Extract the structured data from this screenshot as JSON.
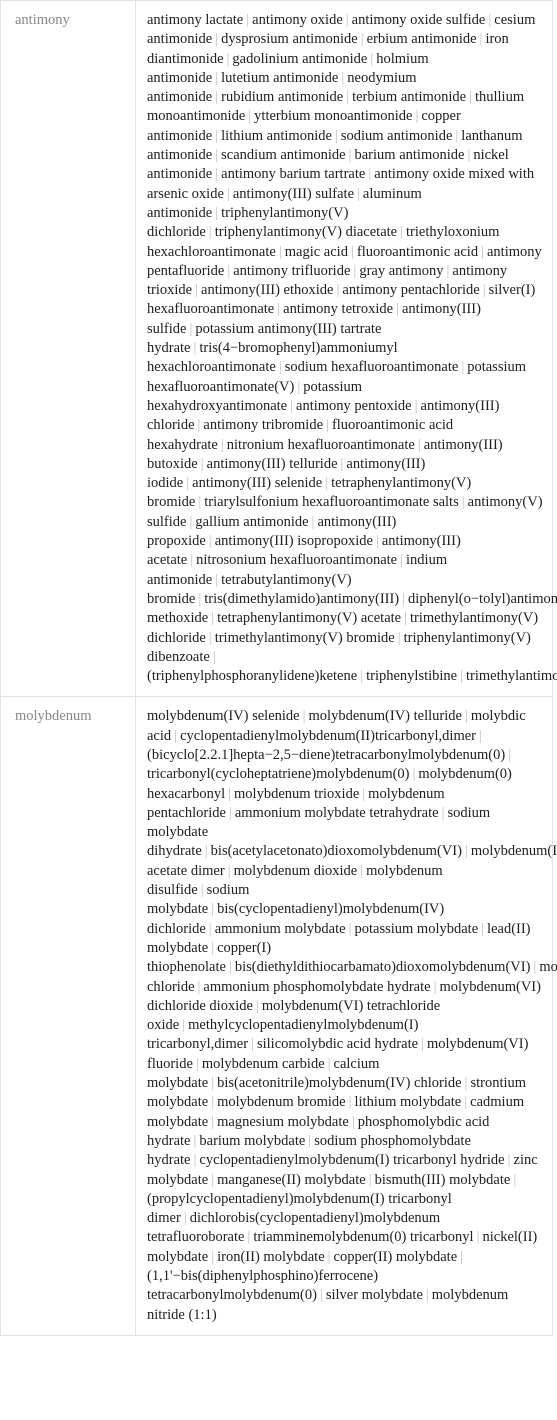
{
  "table": {
    "separator": "|",
    "label_color": "#888888",
    "value_color": "#202020",
    "border_color": "#e2e2e2",
    "separator_color": "#c0c0c0",
    "rows": [
      {
        "label": "antimony",
        "values": [
          "antimony lactate",
          "antimony oxide",
          "antimony oxide sulfide",
          "cesium antimonide",
          "dysprosium antimonide",
          "erbium antimonide",
          "iron diantimonide",
          "gadolinium antimonide",
          "holmium antimonide",
          "lutetium antimonide",
          "neodymium antimonide",
          "rubidium antimonide",
          "terbium antimonide",
          "thullium monoantimonide",
          "ytterbium monoantimonide",
          "copper antimonide",
          "lithium antimonide",
          "sodium antimonide",
          "lanthanum antimonide",
          "scandium antimonide",
          "barium antimonide",
          "nickel antimonide",
          "antimony barium tartrate",
          "antimony oxide mixed with arsenic oxide",
          "antimony(III) sulfate",
          "aluminum antimonide",
          "triphenylantimony(V) dichloride",
          "triphenylantimony(V) diacetate",
          "triethyloxonium hexachloroantimonate",
          "magic acid",
          "fluoroantimonic acid",
          "antimony pentafluoride",
          "antimony trifluoride",
          "gray antimony",
          "antimony trioxide",
          "antimony(III) ethoxide",
          "antimony pentachloride",
          "silver(I) hexafluoroantimonate",
          "antimony tetroxide",
          "antimony(III) sulfide",
          "potassium antimony(III) tartrate hydrate",
          "tris(4−bromophenyl)ammoniumyl hexachloroantimonate",
          "sodium hexafluoroantimonate",
          "potassium hexafluoroantimonate(V)",
          "potassium hexahydroxyantimonate",
          "antimony pentoxide",
          "antimony(III) chloride",
          "antimony tribromide",
          "fluoroantimonic acid hexahydrate",
          "nitronium hexafluoroantimonate",
          "antimony(III) butoxide",
          "antimony(III) telluride",
          "antimony(III) iodide",
          "antimony(III) selenide",
          "tetraphenylantimony(V) bromide",
          "triarylsulfonium hexafluoroantimonate salts",
          "antimony(V) sulfide",
          "gallium antimonide",
          "antimony(III) propoxide",
          "antimony(III) isopropoxide",
          "antimony(III) acetate",
          "nitrosonium hexafluoroantimonate",
          "indium antimonide",
          "tetrabutylantimony(V) bromide",
          "tris(dimethylamido)antimony(III)",
          "diphenyl(o−tolyl)antimony(III)",
          "tetraphenylantimony(V) methoxide",
          "tetraphenylantimony(V) acetate",
          "trimethylantimony(V) dichloride",
          "trimethylantimony(V) bromide",
          "triphenylantimony(V) dibenzoate",
          "(triphenylphosphoranylidene)ketene",
          "triphenylstibine",
          "trimethylantimony"
        ]
      },
      {
        "label": "molybdenum",
        "values": [
          "molybdenum(IV) selenide",
          "molybdenum(IV) telluride",
          "molybdic acid",
          "cyclopentadienylmolybdenum(II)tricarbonyl,dimer",
          "(bicyclo[2.2.1]hepta−2,5−diene)tetracarbonylmolybdenum(0)",
          " tricarbonyl(cycloheptatriene)molybdenum(0)",
          "molybdenum(0) hexacarbonyl",
          "molybdenum trioxide",
          "molybdenum pentachloride",
          "ammonium molybdate tetrahydrate",
          "sodium molybdate dihydrate",
          "bis(acetylacetonato)dioxomolybdenum(VI)",
          "molybdenum(II) acetate dimer",
          "molybdenum dioxide",
          "molybdenum disulfide",
          "sodium molybdate",
          "bis(cyclopentadienyl)molybdenum(IV) dichloride",
          "ammonium molybdate",
          "potassium molybdate",
          "lead(II) molybdate",
          "copper(I) thiophenolate",
          "bis(diethyldithiocarbamato)dioxomolybdenum(VI)",
          "molybdenum(III) chloride",
          "ammonium phosphomolybdate hydrate",
          "molybdenum(VI) dichloride dioxide",
          "molybdenum(VI) tetrachloride oxide",
          "methylcyclopentadienylmolybdenum(I) tricarbonyl,dimer",
          "silicomolybdic acid hydrate",
          "molybdenum(VI) fluoride",
          "molybdenum carbide",
          "calcium molybdate",
          "bis(acetonitrile)molybdenum(IV) chloride",
          "strontium molybdate",
          "molybdenum bromide",
          "lithium molybdate",
          "cadmium molybdate",
          "magnesium molybdate",
          "phosphomolybdic acid hydrate",
          "barium molybdate",
          "sodium phosphomolybdate hydrate",
          "cyclopentadienylmolybdenum(I) tricarbonyl hydride",
          "zinc molybdate",
          "manganese(II) molybdate",
          "bismuth(III) molybdate",
          "(propylcyclopentadienyl)molybdenum(I) tricarbonyl dimer",
          "dichlorobis(cyclopentadienyl)molybdenum tetrafluoroborate",
          "triamminemolybdenum(0) tricarbonyl",
          "nickel(II) molybdate",
          "iron(II) molybdate",
          "copper(II) molybdate",
          "(1,1'−bis(diphenylphosphino)ferrocene) tetracarbonylmolybdenum(0)",
          "silver molybdate",
          "molybdenum nitride (1:1)"
        ]
      }
    ]
  }
}
